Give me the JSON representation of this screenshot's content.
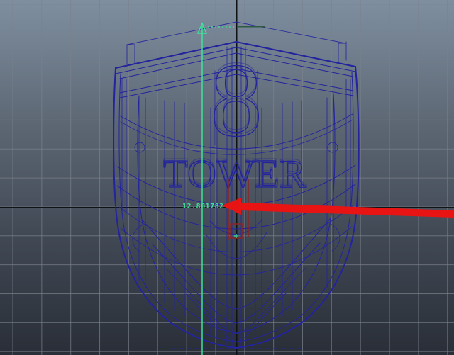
{
  "viewport": {
    "type": "3d-wireframe-viewport",
    "measurement_readout": "12.861782",
    "model": {
      "number_text": "8",
      "name_text": "TOWER"
    }
  },
  "icons": {
    "locator": "locator-triangle-icon",
    "arrow": "annotation-arrow"
  },
  "colors": {
    "bg_top": "#7f8fa0",
    "bg_upper_mid": "#5d6774",
    "bg_lower_mid": "#424a56",
    "bg_bottom": "#292e37",
    "grid_line": "#7b828d",
    "axis": "#0f1316",
    "wire": "#23239e",
    "measure_green": "#3ee29c",
    "measure_green_dark": "#2d5a41",
    "marker_red": "#8c2424",
    "arrow_red": "#e81414"
  }
}
